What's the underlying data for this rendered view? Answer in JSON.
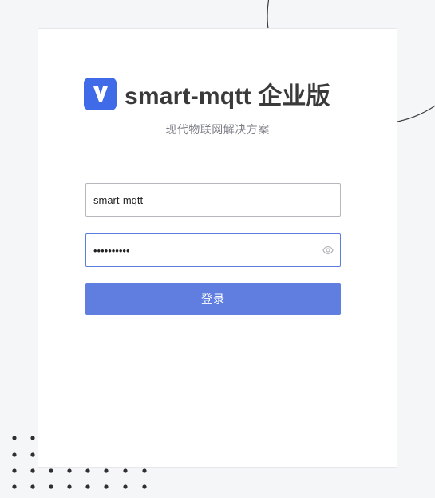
{
  "brand": {
    "logo_letter": "V",
    "name": "smart-mqtt 企业版",
    "subtitle": "现代物联网解决方案"
  },
  "form": {
    "username_value": "smart-mqtt",
    "password_value": "smart-mqtt",
    "submit_label": "登录"
  },
  "colors": {
    "accent": "#5f7ee0",
    "logo": "#3f6ae8",
    "background": "#f5f6f8"
  },
  "icons": {
    "logo": "v-logo-icon",
    "password_toggle": "eye-icon"
  }
}
